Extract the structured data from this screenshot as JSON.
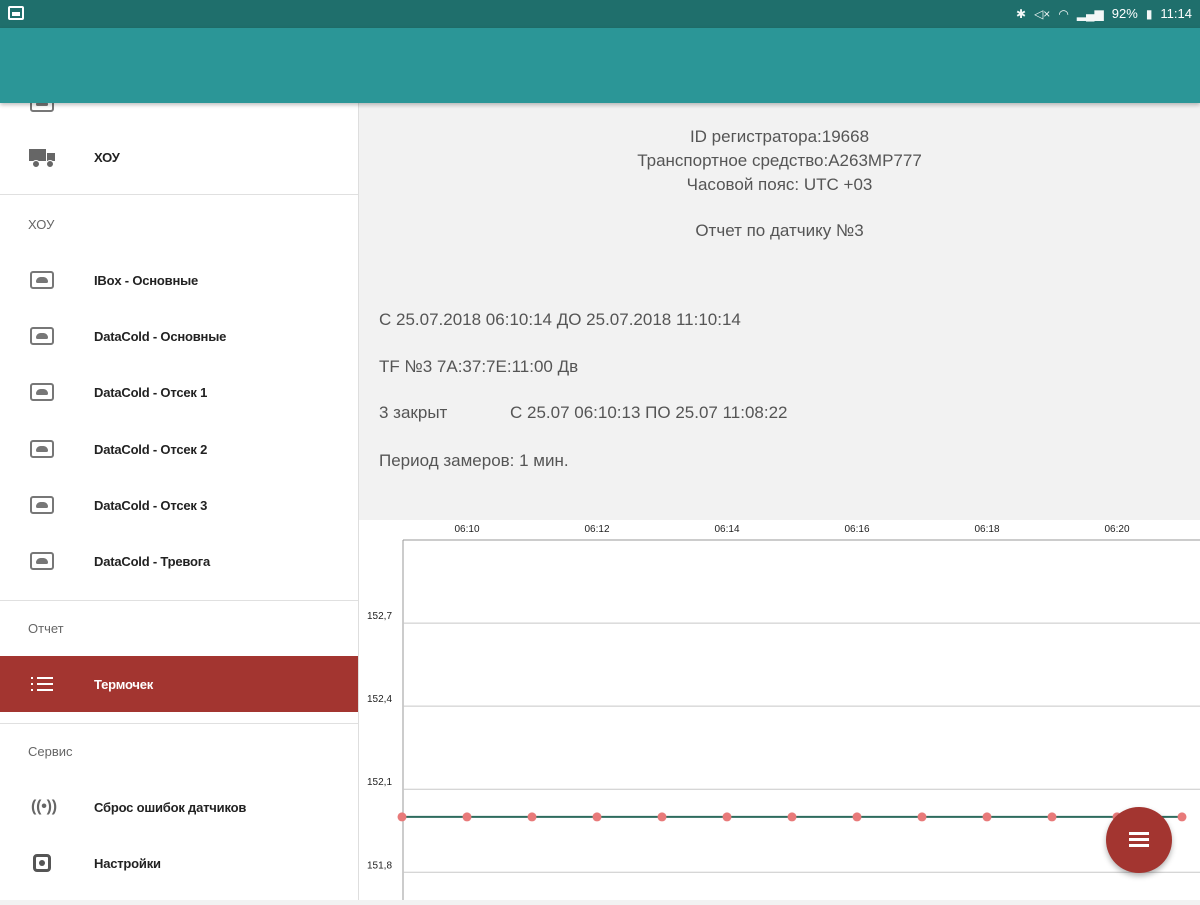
{
  "status_bar": {
    "battery": "92%",
    "time": "11:14"
  },
  "drawer": {
    "top_items": [
      {
        "label": "ХОУ",
        "icon": "truck-icon"
      }
    ],
    "sections": [
      {
        "title": "ХОУ",
        "items": [
          {
            "label": "IBox - Основные",
            "icon": "cloud-box-icon"
          },
          {
            "label": "DataCold - Основные",
            "icon": "cloud-box-icon"
          },
          {
            "label": "DataCold - Отсек 1",
            "icon": "cloud-box-icon"
          },
          {
            "label": "DataCold - Отсек 2",
            "icon": "cloud-box-icon"
          },
          {
            "label": "DataCold - Отсек 3",
            "icon": "cloud-box-icon"
          },
          {
            "label": "DataCold - Тревога",
            "icon": "cloud-box-icon"
          }
        ]
      },
      {
        "title": "Отчет",
        "items": [
          {
            "label": "Термочек",
            "icon": "list-icon",
            "active": true
          }
        ]
      },
      {
        "title": "Сервис",
        "items": [
          {
            "label": "Сброс ошибок датчиков",
            "icon": "antenna-icon"
          },
          {
            "label": "Настройки",
            "icon": "settings-icon"
          }
        ]
      }
    ]
  },
  "report": {
    "recorder_id": "ID регистратора:19668",
    "vehicle": "Транспортное средство:А263МР777",
    "timezone": "Часовой пояс: UTC +03",
    "title": "Отчет по датчику №3",
    "period": "С 25.07.2018 06:10:14 ДО 25.07.2018 11:10:14",
    "tf": "TF №3 7A:37:7E:11:00 Дв",
    "door_state": "3 закрыт",
    "door_period": "С 25.07 06:10:13 ПО 25.07 11:08:22",
    "measure_period": "Период замеров: 1 мин."
  },
  "chart_data": {
    "type": "line",
    "x_tick_labels": [
      "06:10",
      "06:12",
      "06:14",
      "06:16",
      "06:18",
      "06:20"
    ],
    "y_tick_labels": [
      "152,7",
      "152,4",
      "152,1",
      "151,8"
    ],
    "ylim": [
      151.7,
      153.0
    ],
    "x": [
      "06:09",
      "06:10",
      "06:11",
      "06:12",
      "06:13",
      "06:14",
      "06:15",
      "06:16",
      "06:17",
      "06:18",
      "06:19",
      "06:20",
      "06:21"
    ],
    "series": [
      {
        "values": [
          152.0,
          152.0,
          152.0,
          152.0,
          152.0,
          152.0,
          152.0,
          152.0,
          152.0,
          152.0,
          152.0,
          152.0,
          152.0
        ]
      }
    ],
    "line_color": "#2e6b5e",
    "marker_color": "#e87a7a",
    "grid": true
  },
  "colors": {
    "status_bar": "#1f6f6c",
    "app_bar": "#2b9697",
    "accent": "#a33530"
  }
}
